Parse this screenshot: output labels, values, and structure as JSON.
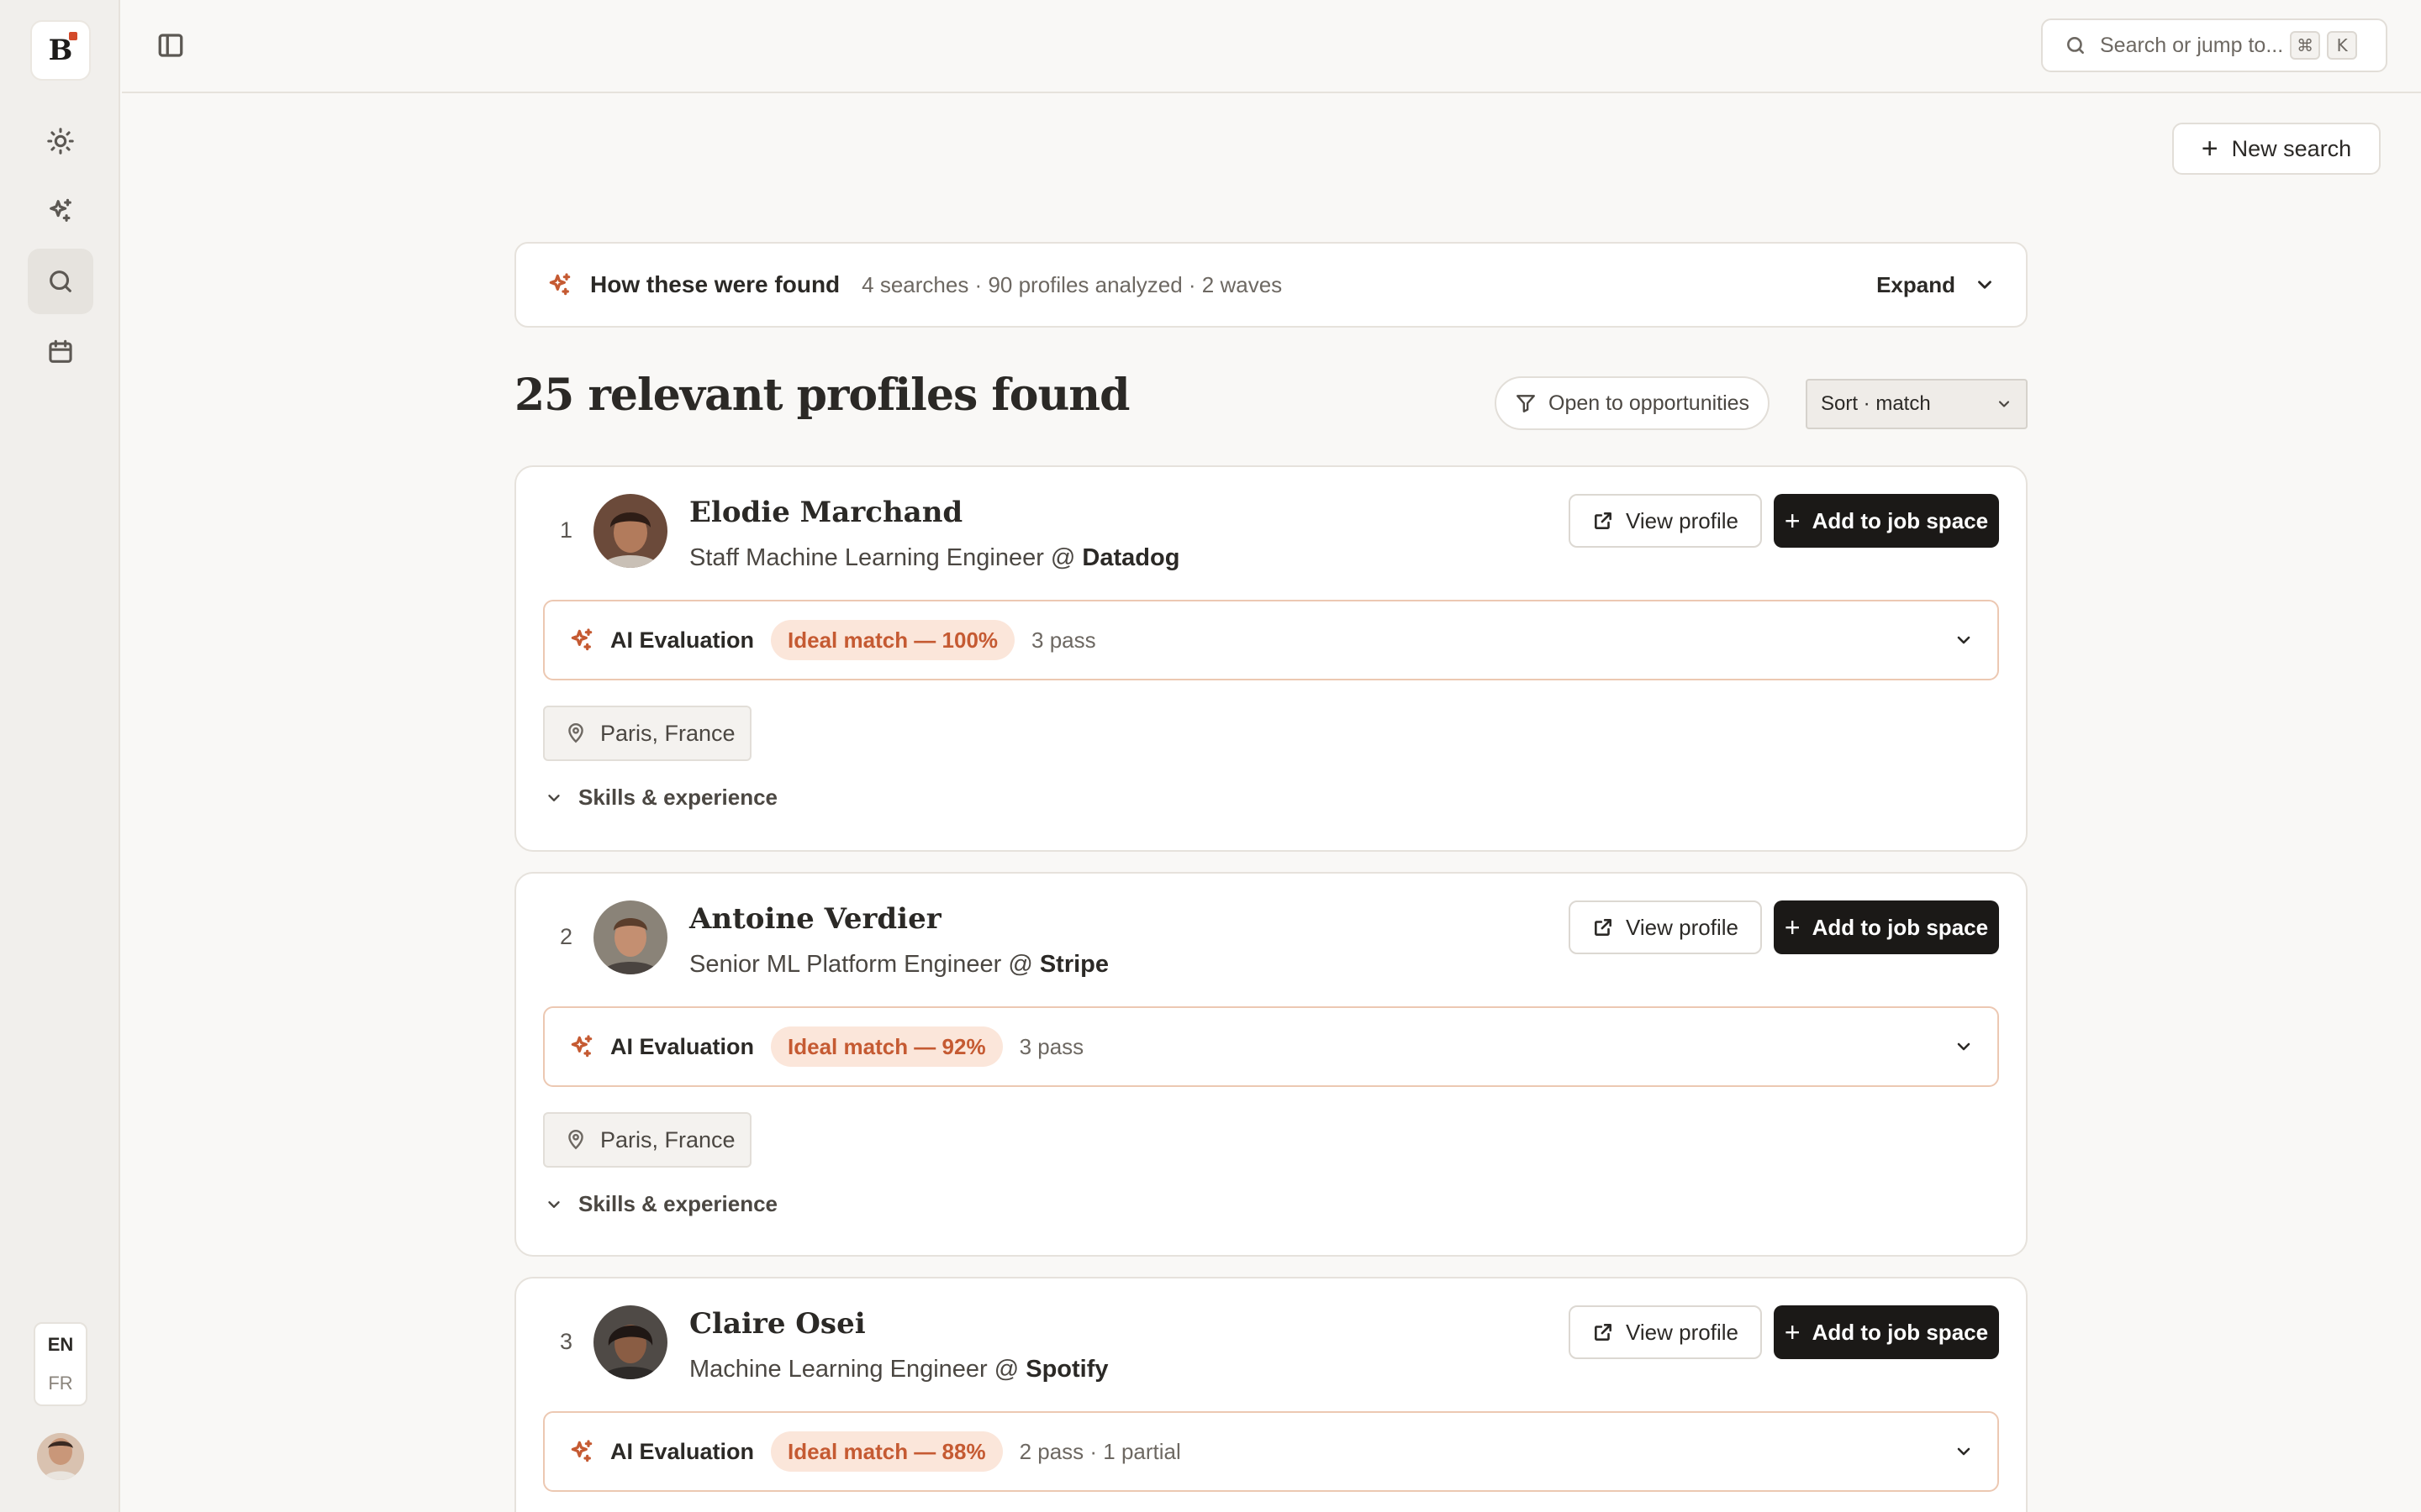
{
  "app": {
    "logo_letter": "B",
    "accent": "#c55a32",
    "nav": [
      {
        "name": "sun-icon",
        "active": false
      },
      {
        "name": "sparkle-icon",
        "active": false
      },
      {
        "name": "search-icon",
        "active": true
      },
      {
        "name": "calendar-icon",
        "active": false
      }
    ],
    "languages": [
      "EN",
      "FR"
    ],
    "selected_language": "EN"
  },
  "topbar": {
    "search_placeholder": "Search or jump to...",
    "shortcut_keys": [
      "⌘",
      "K"
    ],
    "new_search_label": "New search"
  },
  "summary": {
    "title": "How these were found",
    "meta": "4 searches · 90 profiles analyzed · 2 waves",
    "expand_label": "Expand"
  },
  "results": {
    "heading": "25 relevant profiles found",
    "filter_label": "Open to opportunities",
    "sort_label": "Sort · match"
  },
  "profiles": [
    {
      "rank": "1",
      "name": "Elodie Marchand",
      "role": "Staff Machine Learning Engineer @ ",
      "company": "Datadog",
      "view_label": "View profile",
      "add_label": "Add to job space",
      "ai_label": "AI Evaluation",
      "match": "Ideal match — 100%",
      "pass": "3 pass",
      "location": "Paris, France",
      "skills_label": "Skills & experience"
    },
    {
      "rank": "2",
      "name": "Antoine Verdier",
      "role": "Senior ML Platform Engineer @ ",
      "company": "Stripe",
      "view_label": "View profile",
      "add_label": "Add to job space",
      "ai_label": "AI Evaluation",
      "match": "Ideal match — 92%",
      "pass": "3 pass",
      "location": "Paris, France",
      "skills_label": "Skills & experience"
    },
    {
      "rank": "3",
      "name": "Claire Osei",
      "role": "Machine Learning Engineer @ ",
      "company": "Spotify",
      "view_label": "View profile",
      "add_label": "Add to job space",
      "ai_label": "AI Evaluation",
      "match": "Ideal match — 88%",
      "pass": "2 pass · 1 partial"
    }
  ]
}
